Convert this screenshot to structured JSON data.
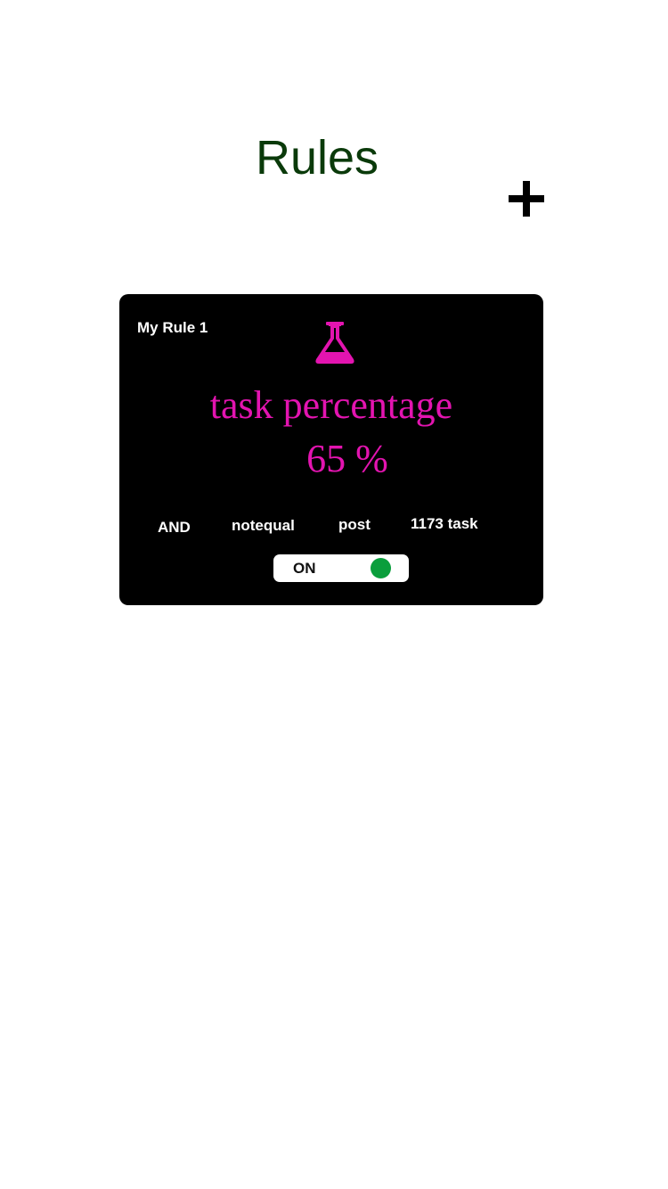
{
  "header": {
    "title": "Rules",
    "title_color": "#0a3a0a",
    "add_icon": "plus-icon"
  },
  "rules": [
    {
      "name": "My Rule 1",
      "icon": "flask-icon",
      "metric": "task percentage",
      "value": "65 %",
      "accent_color": "#e314b0",
      "conditions": {
        "logic": "AND",
        "operator": "notequal",
        "target": "post",
        "threshold": "1173 task"
      },
      "toggle": {
        "label": "ON",
        "state": "on",
        "knob_color": "#0a9e3c"
      }
    }
  ]
}
